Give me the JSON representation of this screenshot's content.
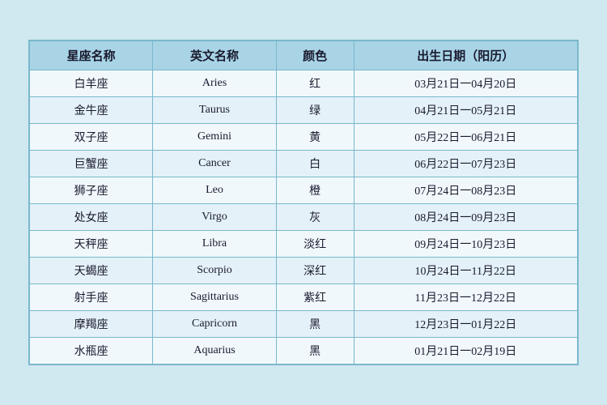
{
  "table": {
    "headers": [
      "星座名称",
      "英文名称",
      "颜色",
      "出生日期（阳历）"
    ],
    "rows": [
      {
        "zh": "白羊座",
        "en": "Aries",
        "color": "红",
        "dates": "03月21日一04月20日"
      },
      {
        "zh": "金牛座",
        "en": "Taurus",
        "color": "绿",
        "dates": "04月21日一05月21日"
      },
      {
        "zh": "双子座",
        "en": "Gemini",
        "color": "黄",
        "dates": "05月22日一06月21日"
      },
      {
        "zh": "巨蟹座",
        "en": "Cancer",
        "color": "白",
        "dates": "06月22日一07月23日"
      },
      {
        "zh": "狮子座",
        "en": "Leo",
        "color": "橙",
        "dates": "07月24日一08月23日"
      },
      {
        "zh": "处女座",
        "en": "Virgo",
        "color": "灰",
        "dates": "08月24日一09月23日"
      },
      {
        "zh": "天秤座",
        "en": "Libra",
        "color": "淡红",
        "dates": "09月24日一10月23日"
      },
      {
        "zh": "天蝎座",
        "en": "Scorpio",
        "color": "深红",
        "dates": "10月24日一11月22日"
      },
      {
        "zh": "射手座",
        "en": "Sagittarius",
        "color": "紫红",
        "dates": "11月23日一12月22日"
      },
      {
        "zh": "摩羯座",
        "en": "Capricorn",
        "color": "黑",
        "dates": "12月23日一01月22日"
      },
      {
        "zh": "水瓶座",
        "en": "Aquarius",
        "color": "黑",
        "dates": "01月21日一02月19日"
      }
    ]
  }
}
